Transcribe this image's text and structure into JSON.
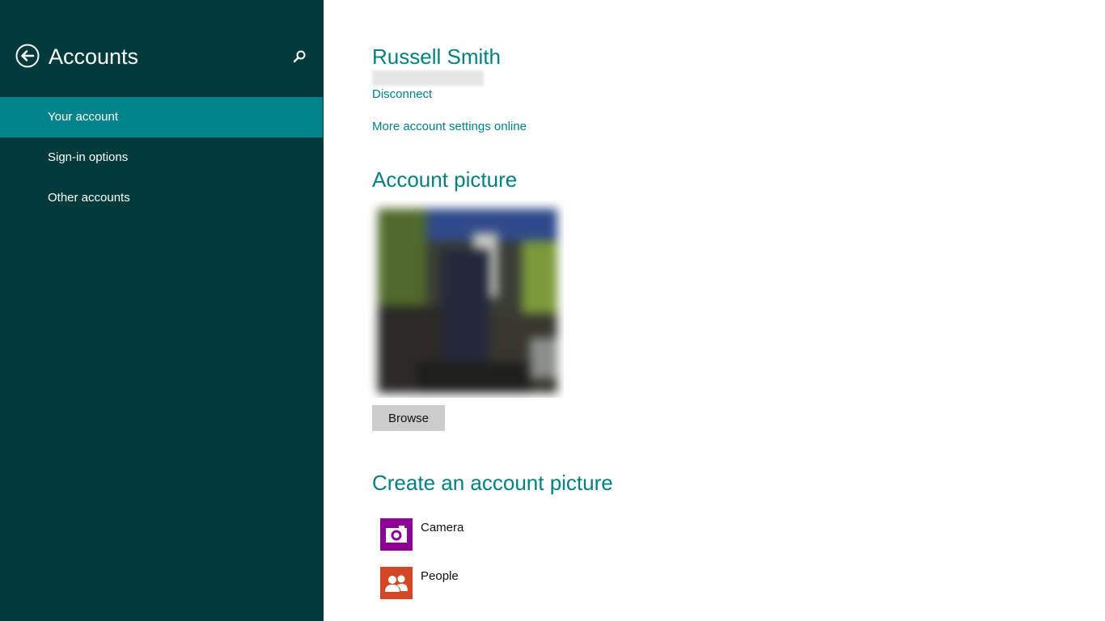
{
  "sidebar": {
    "title": "Accounts",
    "back_icon": "back-arrow-circle-icon",
    "search_icon": "search-icon",
    "items": [
      {
        "label": "Your account",
        "selected": true
      },
      {
        "label": "Sign-in options",
        "selected": false
      },
      {
        "label": "Other accounts",
        "selected": false
      }
    ]
  },
  "account": {
    "name": "Russell Smith",
    "disconnect_label": "Disconnect",
    "more_settings_label": "More account settings online"
  },
  "picture_section": {
    "heading": "Account picture",
    "browse_label": "Browse"
  },
  "create_section": {
    "heading": "Create an account picture",
    "apps": [
      {
        "label": "Camera",
        "icon": "camera-icon",
        "color": "#8c0095"
      },
      {
        "label": "People",
        "icon": "people-icon",
        "color": "#d24726"
      }
    ]
  },
  "colors": {
    "sidebar_bg": "#013a3a",
    "selected_bg": "#00838a",
    "accent": "#008080"
  }
}
